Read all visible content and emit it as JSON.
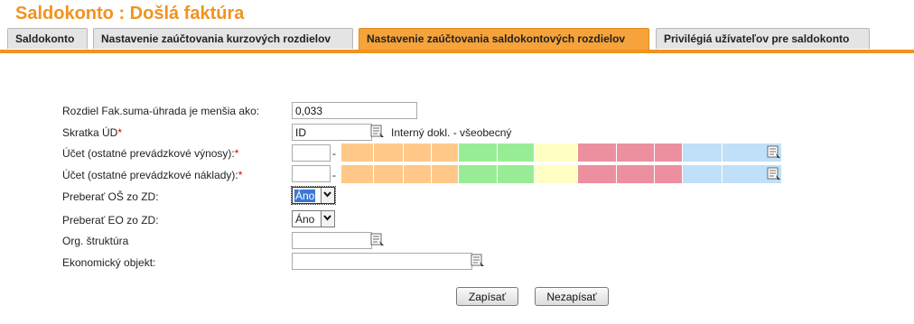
{
  "page": {
    "title": "Saldokonto :  Došlá faktúra"
  },
  "tabs": [
    {
      "label": "Saldokonto"
    },
    {
      "label": "Nastavenie zaúčtovania kurzových rozdielov"
    },
    {
      "label": "Nastavenie zaúčtovania saldokontových rozdielov",
      "active": true
    },
    {
      "label": "Privilégiá užívateľov pre saldokonto"
    }
  ],
  "form": {
    "diff_label": "Rozdiel Fak.suma-úhrada je menšia ako:",
    "diff_value": "0,033",
    "doc_label": "Skratka ÚD",
    "doc_value": "ID",
    "doc_desc": "Interný dokl. - všeobecný",
    "acc_income_label": "Účet (ostatné prevádzkové výnosy):",
    "acc_expense_label": "Účet (ostatné prevádzkové náklady):",
    "required_mark": "*",
    "dash": "-",
    "os_label": "Preberať OŠ zo ZD:",
    "os_value": "Áno",
    "eo_label": "Preberať EO zo ZD:",
    "eo_value": "Áno",
    "org_label": "Org. štruktúra",
    "org_value": "",
    "eko_label": "Ekonomický objekt:",
    "eko_value": ""
  },
  "segment_colors": {
    "orange": "#ffc888",
    "green": "#98ec95",
    "yellow": "#ffffc4",
    "pink": "#ec8f9f",
    "blue": "#bfe0f8"
  },
  "actions": {
    "save_label": "Zapísať",
    "cancel_label": "Nezapísať"
  }
}
